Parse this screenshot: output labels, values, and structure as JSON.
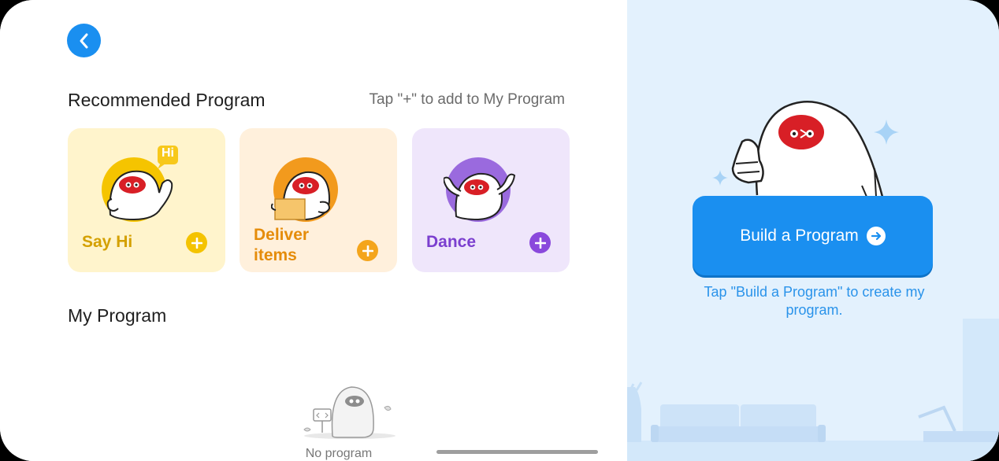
{
  "header": {
    "back_label": ""
  },
  "recommended": {
    "title": "Recommended Program",
    "hint": "Tap \"+\" to add to My Program",
    "cards": [
      {
        "label": "Say Hi",
        "bubble": "Hi",
        "bg": "#fff4cc",
        "accent": "#d4a000",
        "plus": "#f4c300",
        "circle": "#f5c400"
      },
      {
        "label": "Deliver items",
        "label_line1": "Deliver",
        "label_line2": "items",
        "bg": "#fff0dc",
        "accent": "#e58c0a",
        "plus": "#f4a51c",
        "circle": "#f29a1d"
      },
      {
        "label": "Dance",
        "bg": "#efe6fb",
        "accent": "#7b3fcf",
        "plus": "#8a49dc",
        "circle": "#9a6ade"
      }
    ]
  },
  "my_program": {
    "title": "My Program",
    "empty_text": "No program"
  },
  "build": {
    "button_label": "Build a Program",
    "hint": "Tap \"Build a Program\" to create my program."
  },
  "colors": {
    "primary": "#1a8ff0",
    "right_bg": "#e3f1fd"
  }
}
